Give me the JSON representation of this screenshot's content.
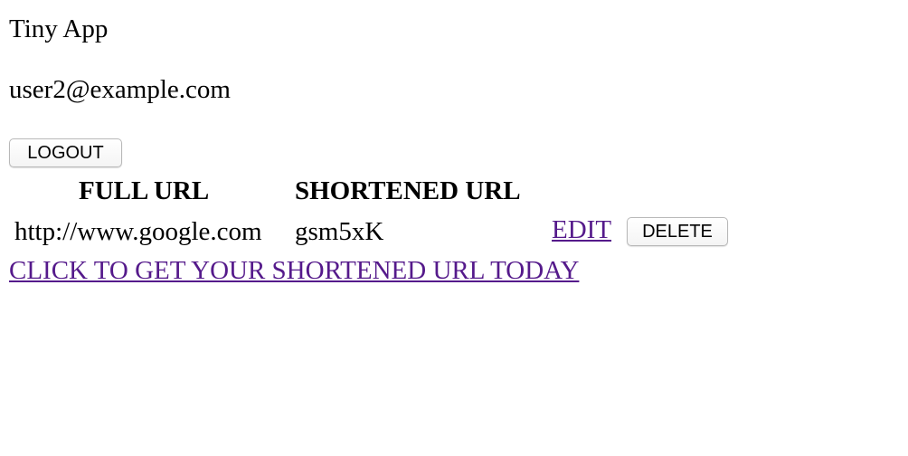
{
  "header": {
    "app_title": "Tiny App",
    "user_email": "user2@example.com",
    "logout_label": "LOGOUT"
  },
  "table": {
    "columns": [
      "FULL URL",
      "SHORTENED URL"
    ],
    "rows": [
      {
        "full_url": "http://www.google.com",
        "short_url": "gsm5xK",
        "edit_label": "EDIT",
        "delete_label": "DELETE"
      }
    ]
  },
  "footer": {
    "cta_label": "CLICK TO GET YOUR SHORTENED URL TODAY"
  },
  "colors": {
    "link": "#551a8b",
    "text": "#000000",
    "background": "#ffffff"
  }
}
